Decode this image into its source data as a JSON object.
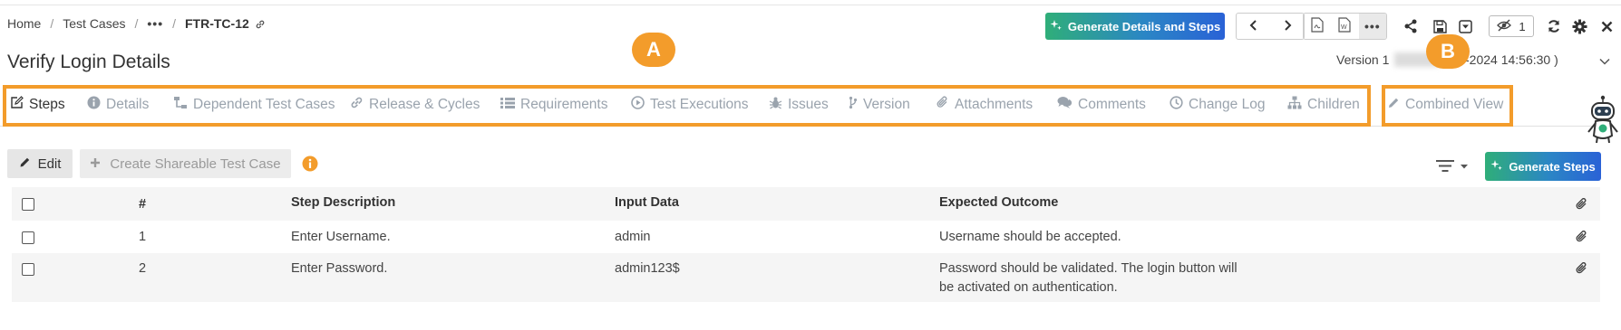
{
  "breadcrumb": {
    "home": "Home",
    "test_cases": "Test Cases",
    "more": "•••",
    "current": "FTR-TC-12"
  },
  "toolbar": {
    "generate_label": "Generate Details and Steps",
    "more_label": "•••",
    "watch_count": "1"
  },
  "page": {
    "title": "Verify Login Details",
    "version_label": "Version 1",
    "version_date": "7-04-2024 14:56:30 )"
  },
  "markers": {
    "a": "A",
    "b": "B"
  },
  "tabs": [
    {
      "label": "Steps",
      "icon": "edit-icon",
      "active": true
    },
    {
      "label": "Details",
      "icon": "info-circle-icon"
    },
    {
      "label": "Dependent Test Cases",
      "icon": "sitemap-icon"
    },
    {
      "label": "Release & Cycles",
      "icon": "link-icon"
    },
    {
      "label": "Requirements",
      "icon": "list-icon"
    },
    {
      "label": "Test Executions",
      "icon": "play-circle-icon"
    },
    {
      "label": "Issues",
      "icon": "bug-icon"
    },
    {
      "label": "Version",
      "icon": "branch-icon"
    },
    {
      "label": "Attachments",
      "icon": "paperclip-icon"
    },
    {
      "label": "Comments",
      "icon": "comments-icon"
    },
    {
      "label": "Change Log",
      "icon": "clock-icon"
    },
    {
      "label": "Children",
      "icon": "hierarchy-icon"
    },
    {
      "label": "Combined View",
      "icon": "pencil-icon"
    }
  ],
  "actions": {
    "edit": "Edit",
    "create_shareable": "Create Shareable Test Case",
    "generate_steps": "Generate Steps"
  },
  "table": {
    "headers": {
      "num": "#",
      "step": "Step Description",
      "input": "Input Data",
      "outcome": "Expected Outcome"
    },
    "rows": [
      {
        "num": "1",
        "step": "Enter Username.",
        "input": "admin",
        "outcome_line1": "Username should be accepted.",
        "outcome_line2": ""
      },
      {
        "num": "2",
        "step": "Enter Password.",
        "input": "admin123$",
        "outcome_line1": "Password should be validated. The login button will",
        "outcome_line2": "be activated on authentication."
      }
    ]
  },
  "colors": {
    "accent_orange": "#f39c2b",
    "gradient_start": "#2fae79",
    "gradient_end": "#2a62d6",
    "muted_tab": "#9aa3ad"
  }
}
